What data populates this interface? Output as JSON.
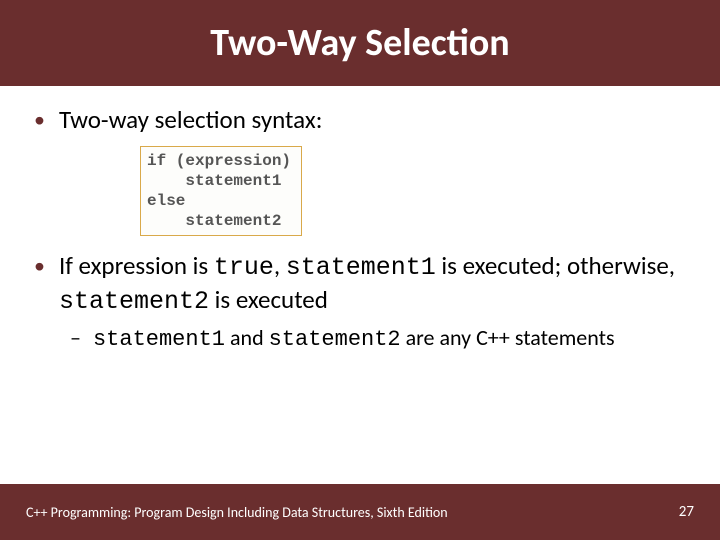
{
  "title": "Two-Way Selection",
  "bullets": {
    "b1": "Two-way selection syntax:",
    "b2_pre": "If expression is ",
    "b2_true": "true",
    "b2_mid1": ", ",
    "b2_stmt1": "statement1",
    "b2_mid2": " is executed; otherwise, ",
    "b2_stmt2": "statement2",
    "b2_post": " is executed",
    "s1_stmt1": "statement1",
    "s1_mid": " and ",
    "s1_stmt2": "statement2",
    "s1_post": " are any C++ statements"
  },
  "code": {
    "l1": "if (expression)",
    "l2": "    statement1",
    "l3": "else",
    "l4": "    statement2"
  },
  "footer": {
    "left": "C++ Programming: Program Design Including Data Structures, Sixth Edition",
    "page": "27"
  }
}
